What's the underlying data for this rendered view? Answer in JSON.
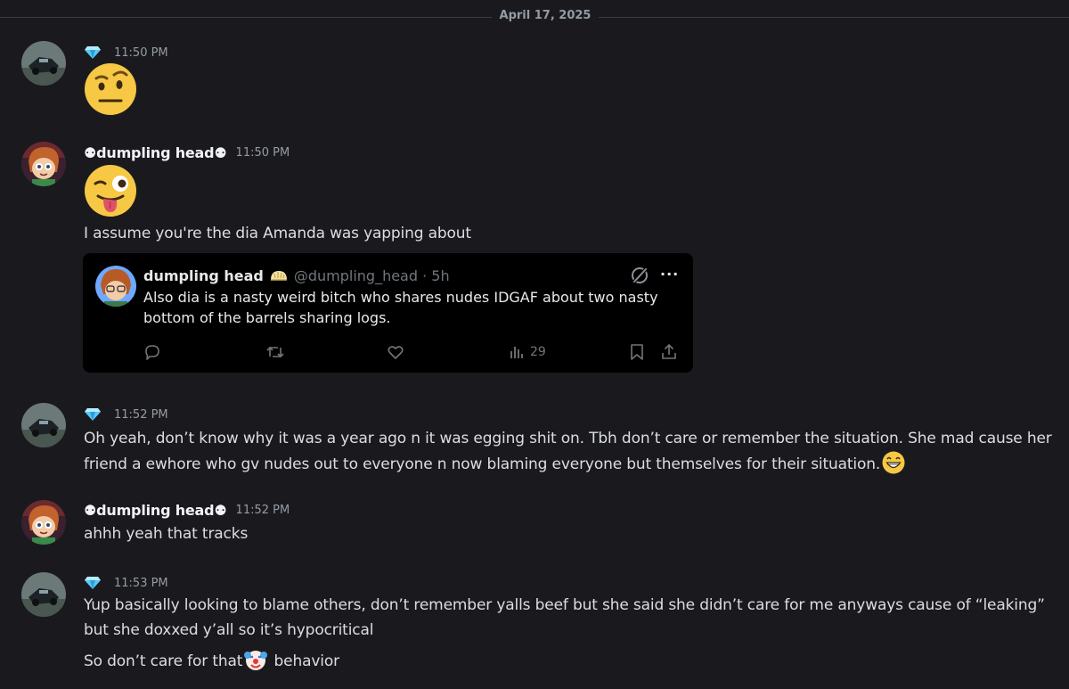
{
  "date_divider": "April 17, 2025",
  "messages": [
    {
      "author": "",
      "time": "11:50 PM",
      "emoji": "face-with-raised-eyebrow"
    },
    {
      "author": "⚉dumpling head⚉",
      "time": "11:50 PM",
      "emoji": "winking-face-with-tongue",
      "text": "I assume you're the dia Amanda was yapping about"
    },
    {
      "author": "",
      "time": "11:52 PM",
      "lines": [
        "Oh yeah, don’t know why it was a year ago n it was egging shit on. Tbh don’t care or remember the situation. She mad cause her",
        "friend a ewhore who gv nudes out to everyone n now blaming everyone but themselves for their situation."
      ],
      "trailing_emoji": "grinning-face"
    },
    {
      "author": "⚉dumpling head⚉",
      "time": "11:52 PM",
      "text": "ahhh yeah that tracks"
    },
    {
      "author": "",
      "time": "11:53 PM",
      "lines": [
        "Yup basically looking to blame others, don’t remember yalls beef but she said she didn’t care for me anyways cause of “leaking”",
        "but she doxxed y’all so it’s hypocritical"
      ],
      "followup": {
        "before": "So don’t care for that",
        "emoji": "clown-face",
        "after": " behavior"
      }
    }
  ],
  "tweet": {
    "name": "dumpling head",
    "badge_icon": "dumpling-emoji",
    "handle_time": "@dumpling_head · 5h",
    "body": "Also dia is a nasty weird bitch who shares nudes IDGAF about two nasty bottom of the barrels sharing logs.",
    "views": "29",
    "more_label": "···"
  },
  "colors": {
    "background": "#1a1a1e",
    "text": "#dbdee1",
    "muted": "#949ba4",
    "gem": "#5ac8fa",
    "tweet_bg": "#000000"
  }
}
